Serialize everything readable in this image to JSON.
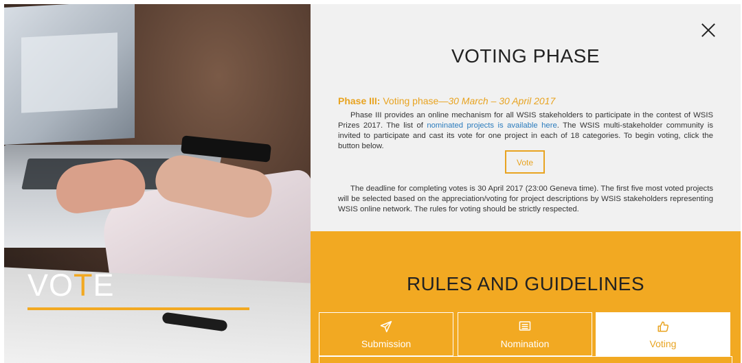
{
  "hero": {
    "word_before": "VO",
    "word_accent": "T",
    "word_after": "E"
  },
  "header": {
    "close_label": "×",
    "title": "VOTING PHASE"
  },
  "phase": {
    "label": "Phase III:",
    "name": " Voting phase—",
    "dates": "30 March – 30 April 2017"
  },
  "intro": {
    "text_before": "Phase III provides an online mechanism for all WSIS stakeholders to participate in the contest of WSIS Prizes 2017. The list of ",
    "link": "nominated projects is available here",
    "text_after": ". The WSIS multi-stakeholder community is invited to participate and cast its vote for one project in each of 18 categories. To begin voting, click the button below."
  },
  "vote_button": "Vote",
  "deadline": {
    "text": "The deadline for completing votes is 30 April 2017 (23:00 Geneva time). The first five most voted projects will be selected based on the appreciation/voting for project descriptions by WSIS stakeholders representing WSIS online network. The rules for voting should be strictly respected."
  },
  "rules": {
    "title": "RULES AND GUIDELINES",
    "tabs": [
      {
        "label": "Submission",
        "icon": "paper-plane-icon"
      },
      {
        "label": "Nomination",
        "icon": "list-icon"
      },
      {
        "label": "Voting",
        "icon": "thumbs-up-icon"
      }
    ],
    "active_tab": "Voting"
  },
  "colors": {
    "accent": "#f2a922",
    "link": "#2a7bbd",
    "panel_bg": "#f1f1f1"
  }
}
